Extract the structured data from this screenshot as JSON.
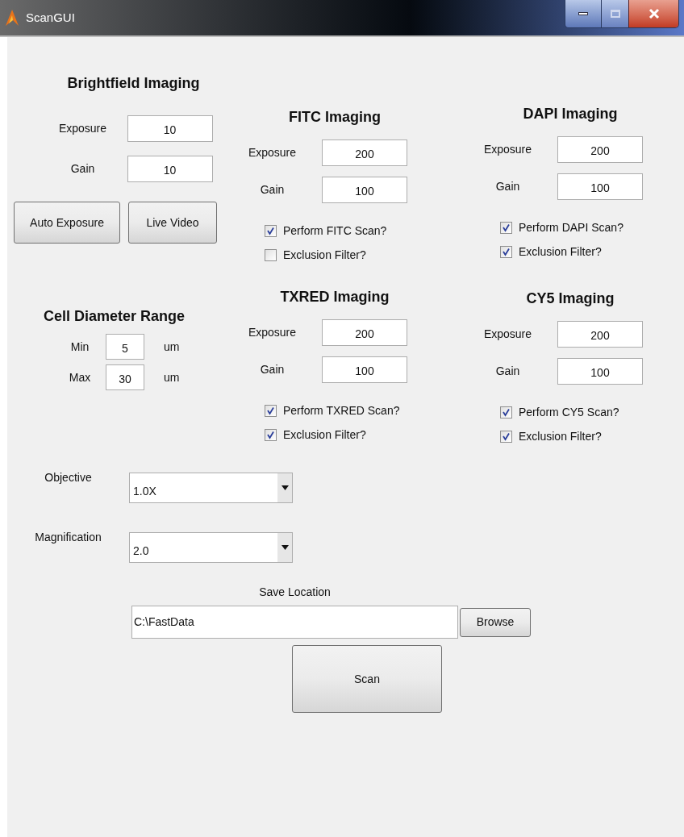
{
  "window": {
    "title": "ScanGUI"
  },
  "brightfield": {
    "title": "Brightfield Imaging",
    "fields": [
      {
        "label": "Exposure",
        "value": "10"
      },
      {
        "label": "Gain",
        "value": "10"
      }
    ],
    "buttons": [
      "Auto Exposure",
      "Live Video"
    ]
  },
  "channels": [
    {
      "title": "FITC Imaging",
      "fields": [
        {
          "label": "Exposure",
          "value": "200"
        },
        {
          "label": "Gain",
          "value": "100"
        }
      ],
      "checkboxes": [
        {
          "label": "Perform FITC Scan?",
          "checked": true
        },
        {
          "label": "Exclusion Filter?",
          "checked": false
        }
      ]
    },
    {
      "title": "DAPI Imaging",
      "fields": [
        {
          "label": "Exposure",
          "value": "200"
        },
        {
          "label": "Gain",
          "value": "100"
        }
      ],
      "checkboxes": [
        {
          "label": "Perform DAPI Scan?",
          "checked": true
        },
        {
          "label": "Exclusion Filter?",
          "checked": true
        }
      ]
    },
    {
      "title": "TXRED Imaging",
      "fields": [
        {
          "label": "Exposure",
          "value": "200"
        },
        {
          "label": "Gain",
          "value": "100"
        }
      ],
      "checkboxes": [
        {
          "label": "Perform TXRED Scan?",
          "checked": true
        },
        {
          "label": "Exclusion Filter?",
          "checked": true
        }
      ]
    },
    {
      "title": "CY5 Imaging",
      "fields": [
        {
          "label": "Exposure",
          "value": "200"
        },
        {
          "label": "Gain",
          "value": "100"
        }
      ],
      "checkboxes": [
        {
          "label": "Perform CY5 Scan?",
          "checked": true
        },
        {
          "label": "Exclusion Filter?",
          "checked": true
        }
      ]
    }
  ],
  "cell_diameter": {
    "title": "Cell Diameter Range",
    "rows": [
      {
        "label": "Min",
        "value": "5",
        "unit": "um"
      },
      {
        "label": "Max",
        "value": "30",
        "unit": "um"
      }
    ]
  },
  "dropdowns": [
    {
      "label": "Objective",
      "value": "1.0X"
    },
    {
      "label": "Magnification",
      "value": "2.0"
    }
  ],
  "save_location": {
    "label": "Save Location",
    "value": "C:\\FastData",
    "button": "Browse"
  },
  "scan_button": "Scan"
}
